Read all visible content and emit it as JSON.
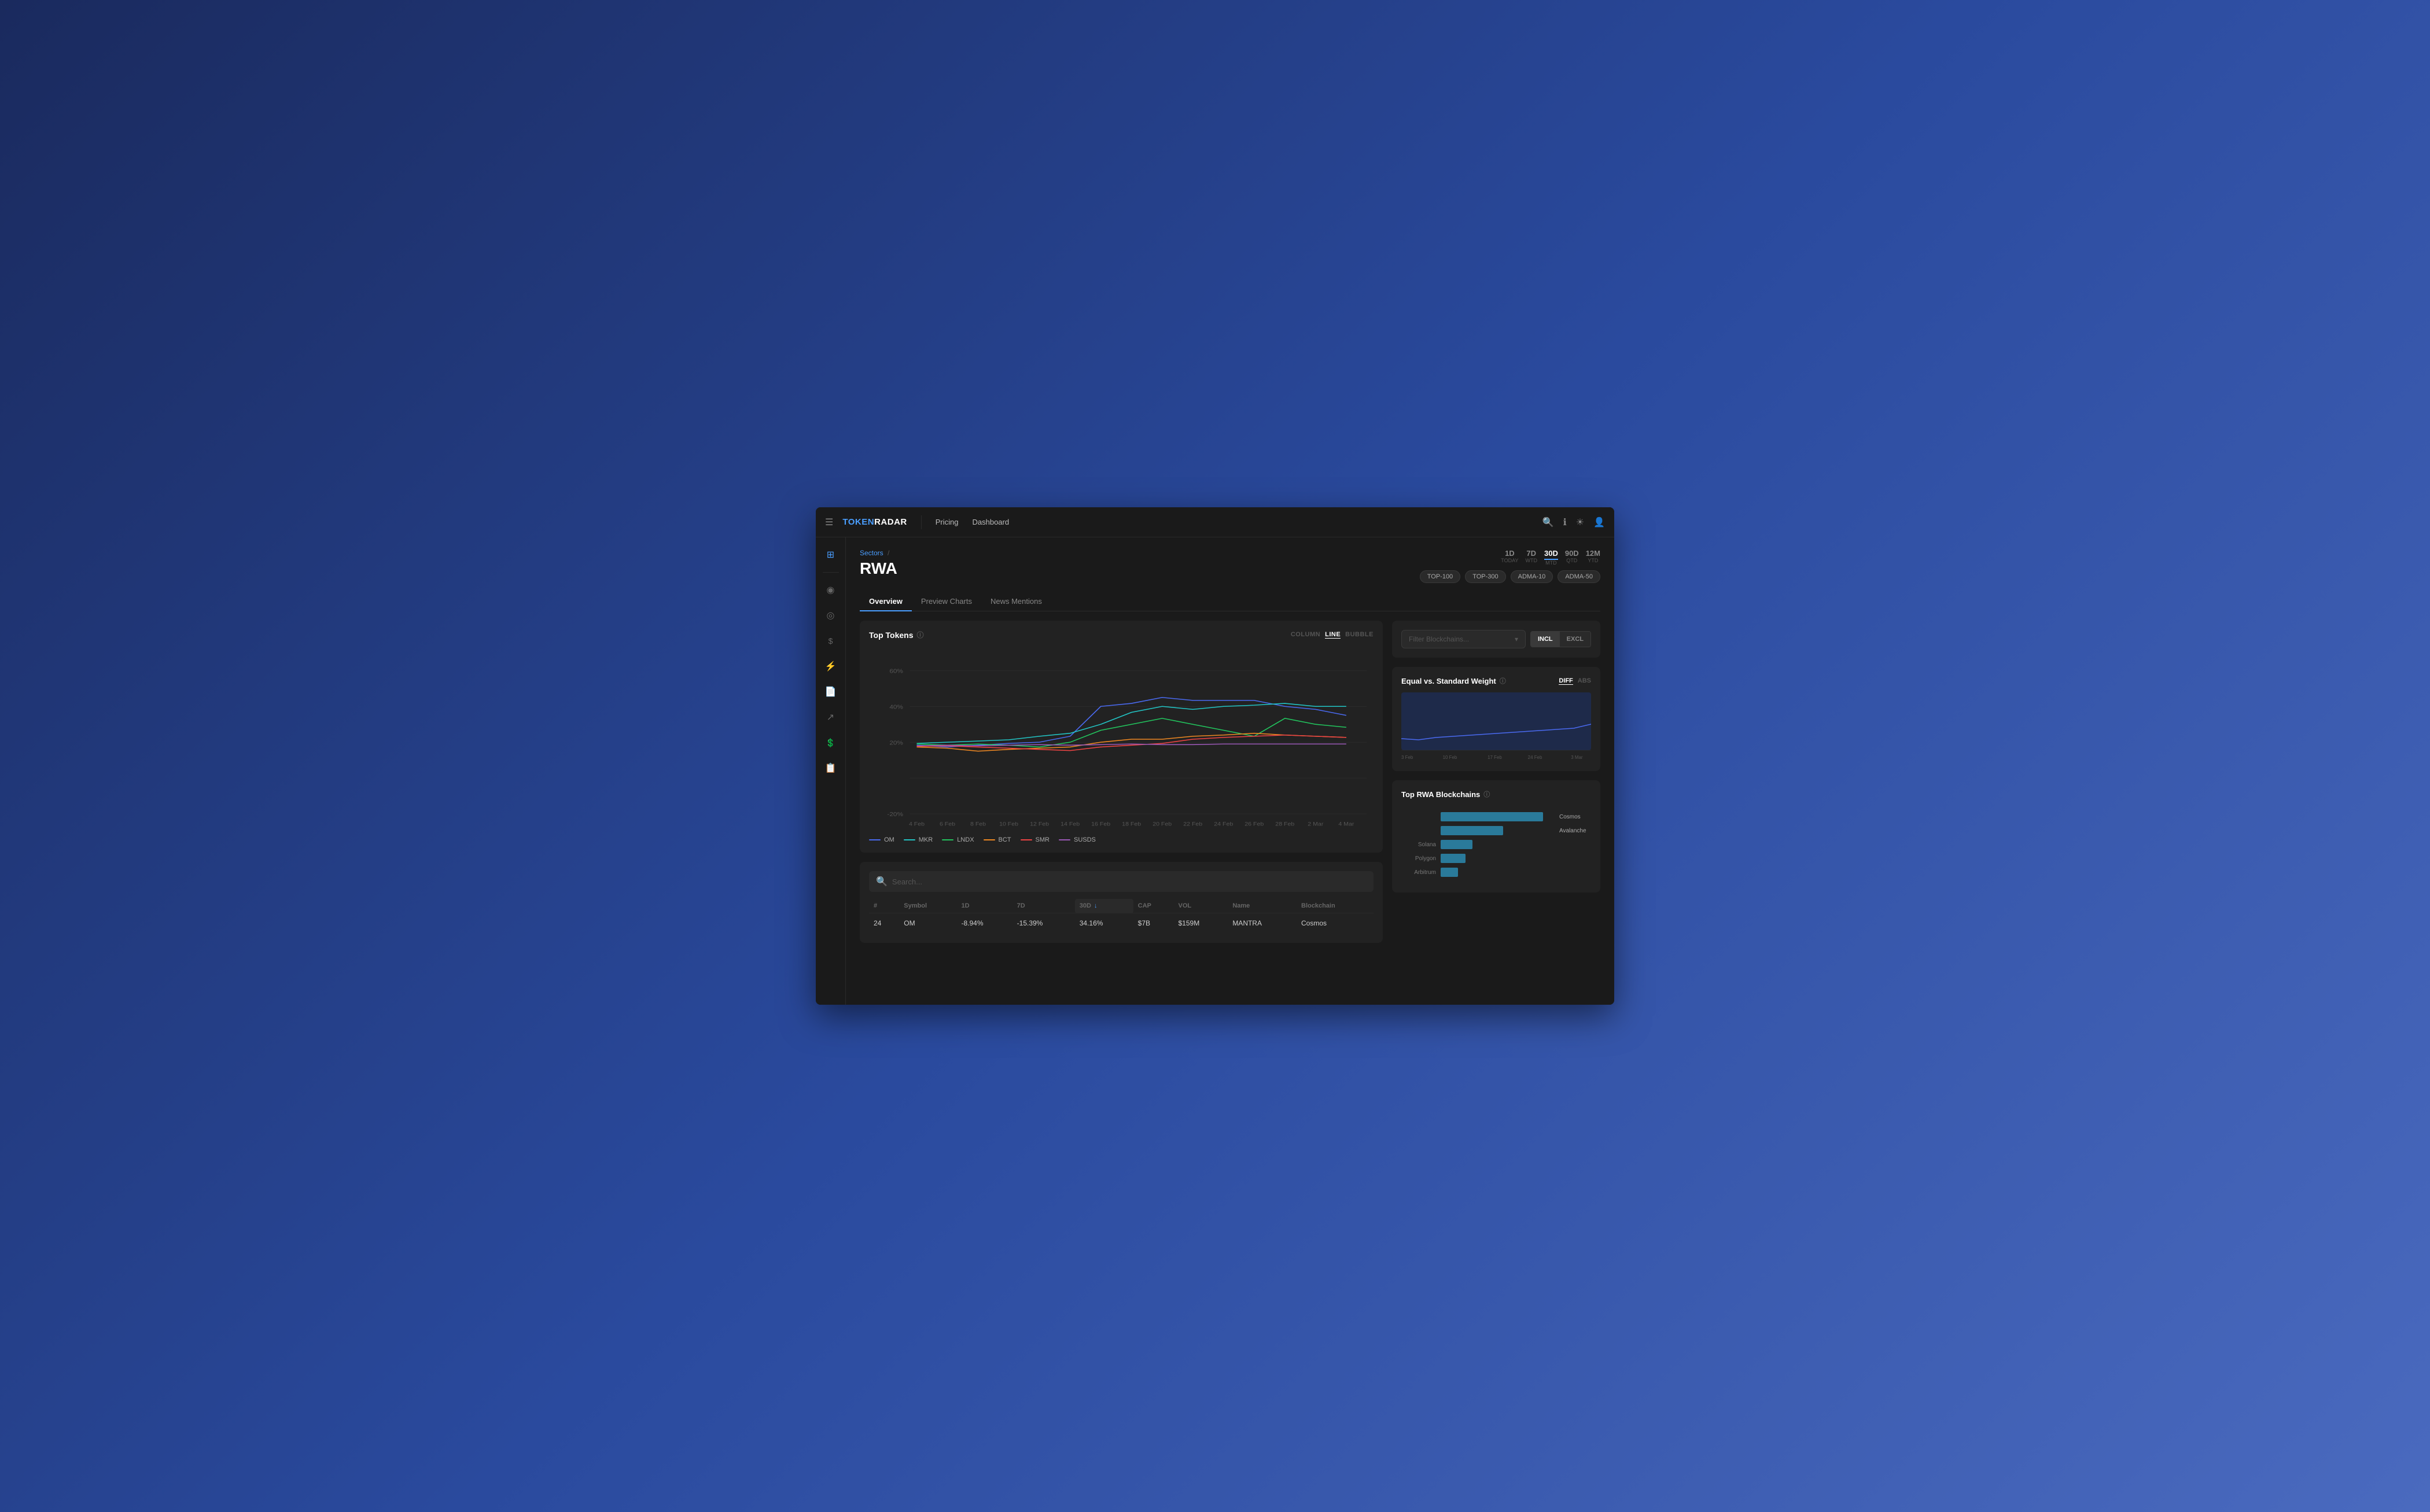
{
  "app": {
    "brand_prefix": "TOKEN",
    "brand_suffix": "RADAR",
    "nav_links": [
      "Pricing",
      "Dashboard"
    ]
  },
  "sidebar": {
    "items": [
      {
        "icon": "⊞",
        "name": "grid-icon"
      },
      {
        "icon": "◉",
        "name": "circle-icon"
      },
      {
        "icon": "◎",
        "name": "target-icon"
      },
      {
        "icon": "$",
        "name": "dollar-icon"
      },
      {
        "icon": "⚡",
        "name": "lightning-icon"
      },
      {
        "icon": "📄",
        "name": "document-icon"
      },
      {
        "icon": "↗",
        "name": "export-icon"
      },
      {
        "icon": "💲",
        "name": "dollar2-icon"
      },
      {
        "icon": "📋",
        "name": "clipboard-icon"
      }
    ]
  },
  "page": {
    "breadcrumb": "Sectors",
    "title": "RWA",
    "time_filters": [
      {
        "value": "1D",
        "label": "TODAY"
      },
      {
        "value": "7D",
        "label": "WTD"
      },
      {
        "value": "30D",
        "label": "MTD",
        "active": true
      },
      {
        "value": "90D",
        "label": "QTD"
      },
      {
        "value": "12M",
        "label": "YTD"
      }
    ],
    "filter_tags": [
      "TOP-100",
      "TOP-300",
      "ADMA-10",
      "ADMA-50"
    ]
  },
  "tabs": [
    {
      "label": "Overview",
      "active": true
    },
    {
      "label": "Preview Charts"
    },
    {
      "label": "News Mentions"
    }
  ],
  "chart": {
    "title": "Top Tokens",
    "info": "ⓘ",
    "type_btns": [
      {
        "label": "COLUMN"
      },
      {
        "label": "LINE",
        "active": true
      },
      {
        "label": "BUBBLE"
      }
    ],
    "y_labels": [
      "60%",
      "40%",
      "20%",
      "-20%"
    ],
    "x_labels": [
      "4 Feb",
      "6 Feb",
      "8 Feb",
      "10 Feb",
      "12 Feb",
      "14 Feb",
      "16 Feb",
      "18 Feb",
      "20 Feb",
      "22 Feb",
      "24 Feb",
      "26 Feb",
      "28 Feb",
      "2 Mar",
      "4 Mar"
    ],
    "legend": [
      {
        "symbol": "OM",
        "color": "#4a6af0"
      },
      {
        "symbol": "MKR",
        "color": "#22c5c5"
      },
      {
        "symbol": "LNDX",
        "color": "#22c55e"
      },
      {
        "symbol": "BCT",
        "color": "#ef8822"
      },
      {
        "symbol": "SMR",
        "color": "#ef4444"
      },
      {
        "symbol": "SUSDS",
        "color": "#9b59b6"
      }
    ]
  },
  "table": {
    "search_placeholder": "Search...",
    "columns": [
      "#",
      "Symbol",
      "1D",
      "7D",
      "30D",
      "CAP",
      "VOL",
      "Name",
      "Blockchain"
    ],
    "rows": [
      {
        "rank": "24",
        "symbol": "OM",
        "d1": "-8.94%",
        "d1_class": "negative",
        "d7": "-15.39%",
        "d7_class": "negative",
        "d30": "34.16%",
        "d30_class": "positive",
        "cap": "$7B",
        "vol": "$159M",
        "name": "MANTRA",
        "blockchain": "Cosmos"
      }
    ]
  },
  "right_panel": {
    "blockchain_filter": {
      "placeholder": "Filter Blockchains...",
      "incl_label": "INCL",
      "excl_label": "EXCL"
    },
    "equal_weight": {
      "title": "Equal vs. Standard Weight",
      "info": "ⓘ",
      "diff_label": "DIFF",
      "abs_label": "ABS",
      "x_labels": [
        "3 Feb",
        "10 Feb",
        "17 Feb",
        "24 Feb",
        "3 Mar"
      ]
    },
    "top_blockchains": {
      "title": "Top RWA Blockchains",
      "info": "ⓘ",
      "items": [
        {
          "name": "Cosmos",
          "width": 90
        },
        {
          "name": "Avalanche",
          "width": 55
        },
        {
          "name": "Solana",
          "width": 28
        },
        {
          "name": "Polygon",
          "width": 22
        },
        {
          "name": "Arbitrum",
          "width": 15
        }
      ]
    }
  }
}
